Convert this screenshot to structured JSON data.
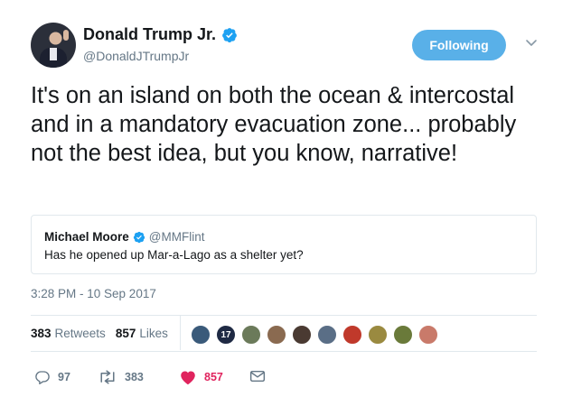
{
  "author": {
    "display_name": "Donald Trump Jr.",
    "handle": "@DonaldJTrumpJr",
    "avatar": "profile-photo",
    "verified": true
  },
  "follow_button": {
    "label": "Following",
    "color": "#59b0e8"
  },
  "menu": {
    "icon": "chevron-down-icon"
  },
  "tweet": {
    "text": "It's on an island on both the ocean & intercostal and in a mandatory evacuation zone... probably not the best idea, but you know, narrative!"
  },
  "quoted_tweet": {
    "display_name": "Michael Moore",
    "handle": "@MMFlint",
    "verified": true,
    "text": "Has he opened up Mar-a-Lago as a shelter yet?"
  },
  "timestamp": "3:28 PM - 10 Sep 2017",
  "stats": {
    "retweets_count": "383",
    "retweets_label": "Retweets",
    "likes_count": "857",
    "likes_label": "Likes"
  },
  "likers": [
    {
      "label": "",
      "color": "#3a5a7a"
    },
    {
      "label": "17",
      "color": "#1f2a44"
    },
    {
      "label": "",
      "color": "#6b7a5a"
    },
    {
      "label": "",
      "color": "#8a6a50"
    },
    {
      "label": "",
      "color": "#4a3a32"
    },
    {
      "label": "",
      "color": "#5a6e86"
    },
    {
      "label": "",
      "color": "#c0392b"
    },
    {
      "label": "",
      "color": "#9a8a40"
    },
    {
      "label": "",
      "color": "#6a7a3a"
    },
    {
      "label": "",
      "color": "#c97a6a"
    }
  ],
  "actions": {
    "reply": {
      "icon": "reply-icon",
      "count": "97"
    },
    "retweet": {
      "icon": "retweet-icon",
      "count": "383"
    },
    "like": {
      "icon": "heart-icon",
      "count": "857",
      "color": "#e0245e"
    },
    "message": {
      "icon": "envelope-icon"
    }
  },
  "colors": {
    "verified_blue": "#1da1f2",
    "secondary_text": "#657786",
    "border": "#e1e8ed"
  }
}
